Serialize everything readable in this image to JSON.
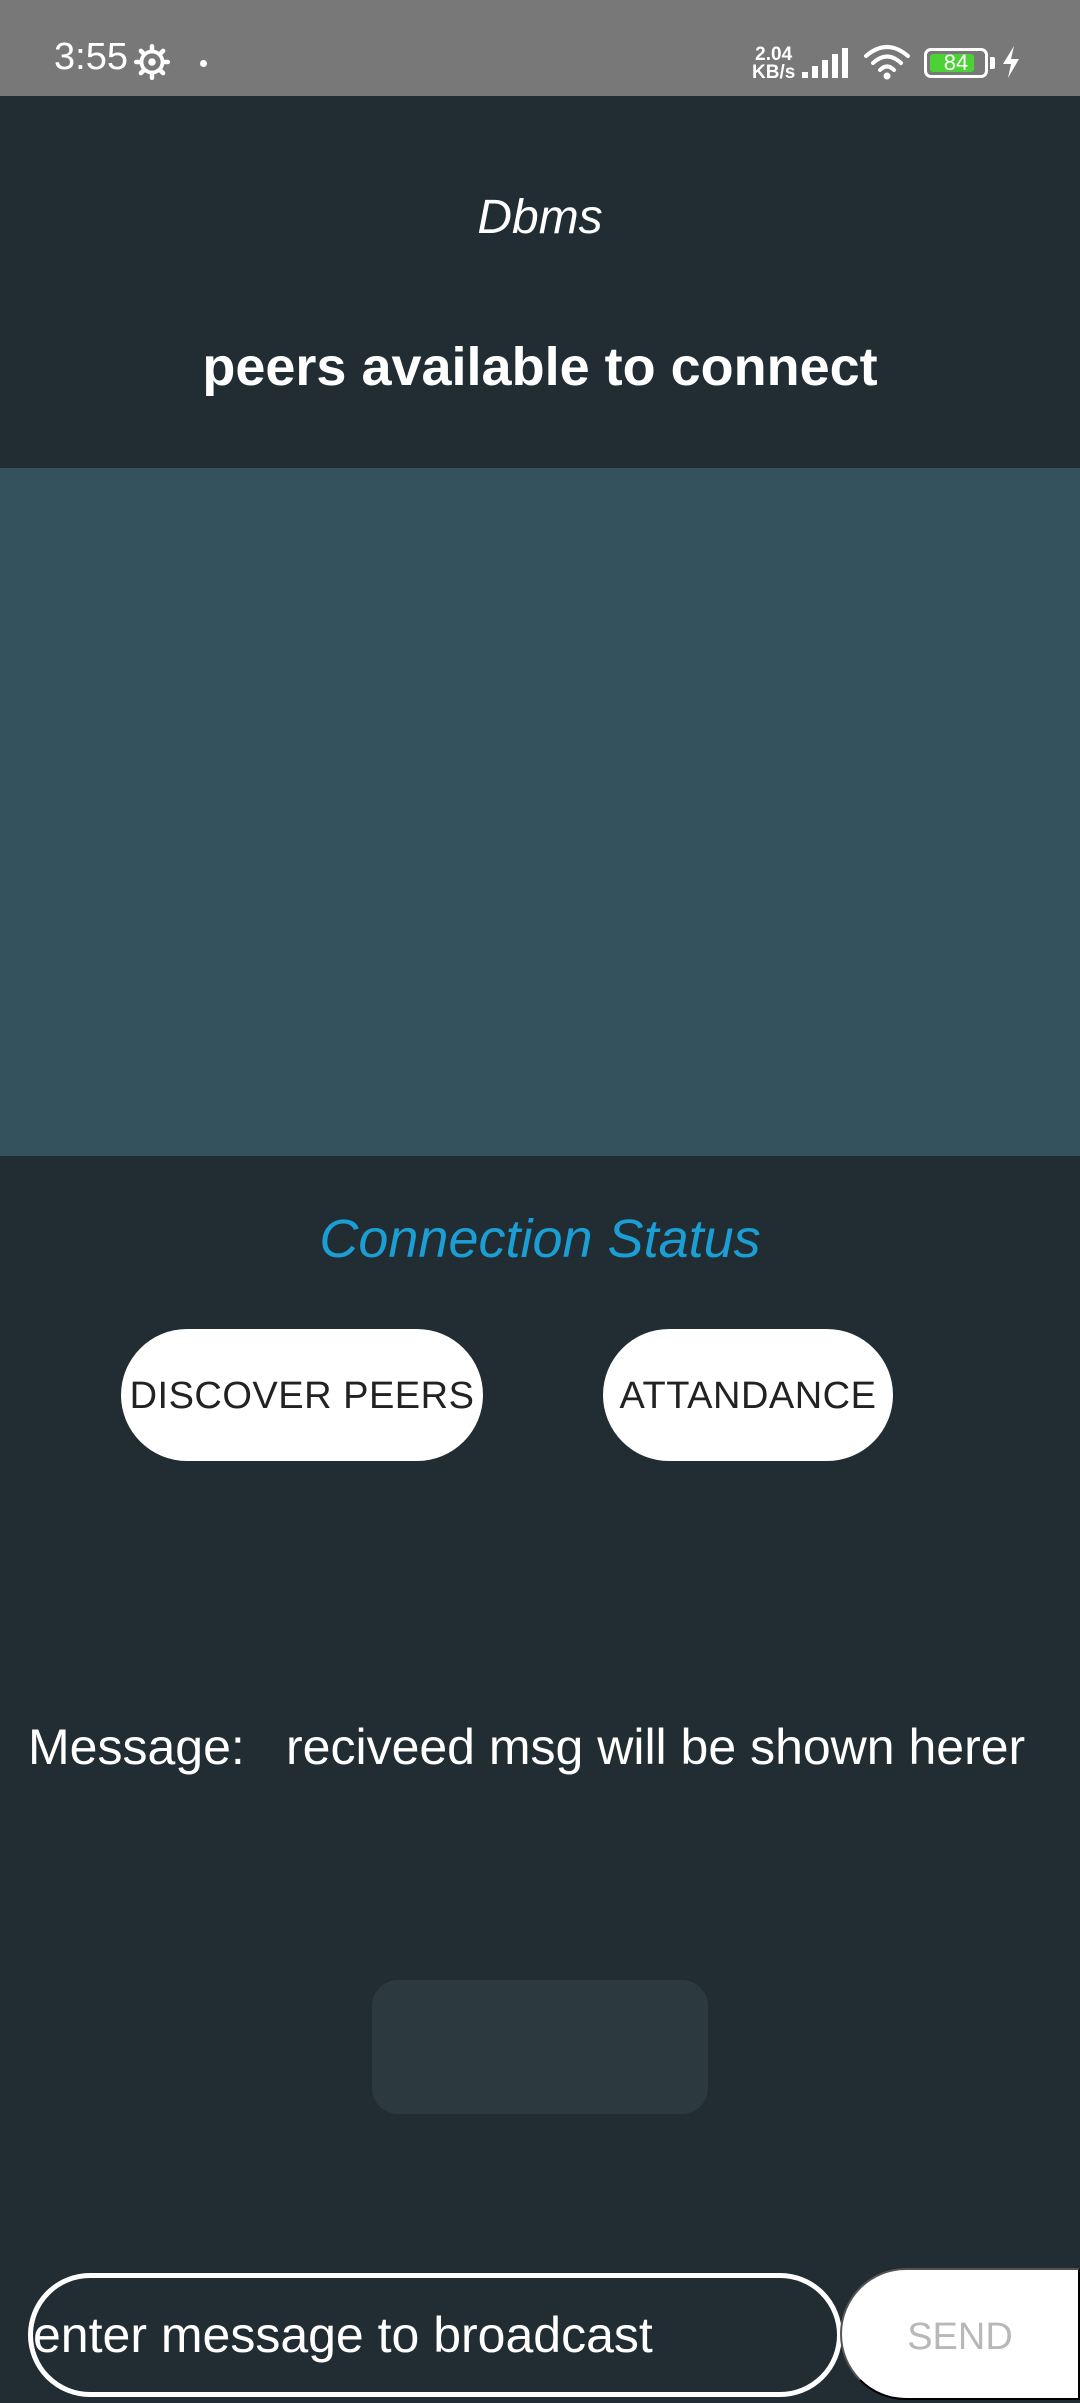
{
  "status_bar": {
    "time": "3:55",
    "net_speed_value": "2.04",
    "net_speed_unit": "KB/s",
    "battery_level": "84",
    "battery_fraction": 0.84,
    "battery_color": "#4cd137",
    "icons": [
      "gear-icon",
      "signal-icon",
      "wifi-icon",
      "battery-icon",
      "charging-bolt-icon"
    ]
  },
  "header": {
    "app_title": "Dbms",
    "peers_heading": "peers available to connect"
  },
  "peer_list": {
    "items": []
  },
  "connection": {
    "status_label": "Connection Status",
    "status_color": "#1b9ed3"
  },
  "buttons": {
    "discover_peers": "DISCOVER PEERS",
    "attendance": "ATTANDANCE"
  },
  "message": {
    "label": "Message:",
    "value": "reciveed msg will be shown herer"
  },
  "broadcast": {
    "placeholder": "enter message to broadcast",
    "send_label": "SEND"
  }
}
